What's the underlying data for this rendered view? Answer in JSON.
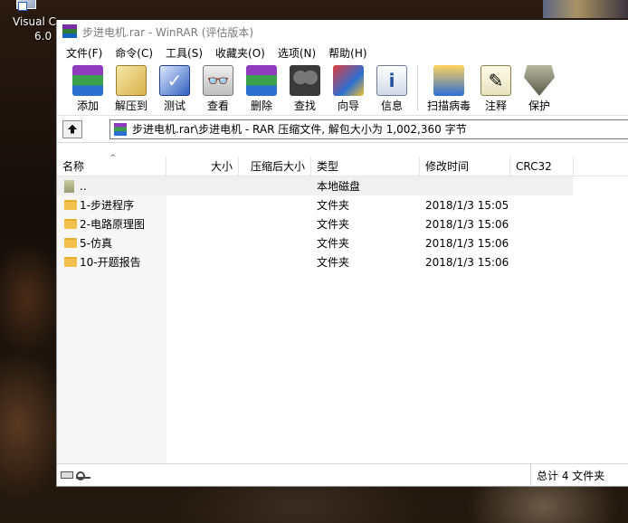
{
  "desktop": {
    "icon_label_line1": "Visual C",
    "icon_label_line2": "6.0"
  },
  "window": {
    "title": "步进电机.rar - WinRAR (评估版本)"
  },
  "menu": [
    "文件(F)",
    "命令(C)",
    "工具(S)",
    "收藏夹(O)",
    "选项(N)",
    "帮助(H)"
  ],
  "toolbar": {
    "add": "添加",
    "extract": "解压到",
    "test": "测试",
    "view": "查看",
    "delete": "删除",
    "find": "查找",
    "wizard": "向导",
    "info": "信息",
    "virus_scan": "扫描病毒",
    "comment": "注释",
    "protect": "保护"
  },
  "address": {
    "path": "步进电机.rar\\步进电机 - RAR 压缩文件, 解包大小为 1,002,360 字节"
  },
  "columns": {
    "name": "名称",
    "size": "大小",
    "packed": "压缩后大小",
    "type": "类型",
    "modified": "修改时间",
    "crc": "CRC32"
  },
  "rows": [
    {
      "name": "..",
      "type": "本地磁盘",
      "modified": ""
    },
    {
      "name": "1-步进程序",
      "type": "文件夹",
      "modified": "2018/1/3 15:05"
    },
    {
      "name": "2-电路原理图",
      "type": "文件夹",
      "modified": "2018/1/3 15:06"
    },
    {
      "name": "5-仿真",
      "type": "文件夹",
      "modified": "2018/1/3 15:06"
    },
    {
      "name": "10-开题报告",
      "type": "文件夹",
      "modified": "2018/1/3 15:06"
    }
  ],
  "status": {
    "summary": "总计 4 文件夹"
  }
}
